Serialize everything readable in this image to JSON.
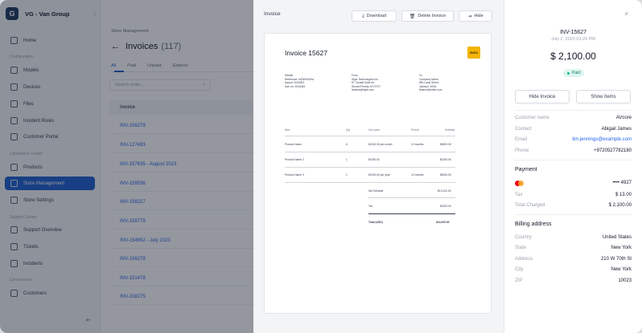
{
  "brand": {
    "initial": "G",
    "name": "VG - Van Group",
    "chevron": "›"
  },
  "sidebar": {
    "sections": {
      "configuration": "Configuration",
      "commerce": "Commerce Center",
      "support": "Support Center",
      "connections": "Connections"
    },
    "items": [
      {
        "label": "Home"
      },
      {
        "label": "Models"
      },
      {
        "label": "Devices"
      },
      {
        "label": "Files"
      },
      {
        "label": "Incident Rules"
      },
      {
        "label": "Customer Portal"
      },
      {
        "label": "Products"
      },
      {
        "label": "Store Management"
      },
      {
        "label": "Store Settings"
      },
      {
        "label": "Support Overview"
      },
      {
        "label": "Tickets"
      },
      {
        "label": "Incidents"
      },
      {
        "label": "Customers"
      }
    ],
    "collapse_icon": "⇤"
  },
  "main": {
    "breadcrumb": "Store Management",
    "title": "Invoices",
    "count": "(117)",
    "back_icon": "←",
    "tabs": [
      "All",
      "Paid",
      "Unpaid",
      "Expired"
    ],
    "search_placeholder": "Search order...",
    "search_icon": "⌕",
    "column": "Invoice",
    "rows": [
      "INV-156279",
      "INV-127493",
      "INV-157635 - August 2023",
      "INV-159536",
      "INV-156227",
      "INV-158779",
      "INV-154652 - July 2023",
      "INV-156279",
      "INV-151478",
      "INV-158275"
    ]
  },
  "preview": {
    "title": "Invoice",
    "download": "Download",
    "delete": "Delete Invoice",
    "hide": "Hide",
    "doc": {
      "title": "Invoice 15627",
      "logo_text": "AVCO",
      "details": [
        "Details",
        "Reference: M20EHU09a",
        "Issued: 2034/8/1",
        "Due on: 2034/8/4"
      ],
      "from": [
        "From",
        "Style Technologies Inc.",
        "87 Tyndall Suite #a",
        "Stoned Florida, M 07077",
        "finance@style.com"
      ],
      "to": [
        "To",
        "Company Name",
        "890 Lassi Street,",
        "Jackson, 8234",
        "finance@other.com"
      ],
      "headers": [
        "Item",
        "Qty",
        "Unit price",
        "Period",
        "Subtotal"
      ],
      "items": [
        [
          "Product Name",
          "6",
          "$1000.00 per month",
          "12 months",
          "$5000.00"
        ],
        [
          "Product Name 2",
          "1",
          "$1000.00",
          "",
          "$1000.00"
        ],
        [
          "Product Name 3",
          "1",
          "$1000.00 per year",
          "12 months",
          "$5000.00"
        ]
      ],
      "subtotal_label": "Net Subtotal",
      "subtotal": "$12,000.00",
      "tax_label": "Tax",
      "tax": "$2000.00",
      "total_label": "Total (USD)",
      "total": "$14,000.00"
    }
  },
  "detail": {
    "close_icon": "×",
    "id": "INV-15627",
    "date": "July 2, 2020 03:29 PM",
    "amount": "$ 2,100.00",
    "status": "Paid",
    "hide_btn": "Hide Invoice",
    "show_btn": "Show Items",
    "customer": [
      {
        "k": "Customer name",
        "v": "AVcore"
      },
      {
        "k": "Contact",
        "v": "Abigail James"
      },
      {
        "k": "Email",
        "v": "tim.jennings@example.com"
      },
      {
        "k": "Phone",
        "v": "+972052778218​0"
      }
    ],
    "payment_title": "Payment",
    "card": "•••• 4927",
    "payment": [
      {
        "k": "Tax",
        "v": "$ 13.00"
      },
      {
        "k": "Total Charged",
        "v": "$ 2,100.00"
      }
    ],
    "billing_title": "Billing address",
    "billing": [
      {
        "k": "Country",
        "v": "United States"
      },
      {
        "k": "State",
        "v": "New York"
      },
      {
        "k": "Address",
        "v": "210 W 70th St"
      },
      {
        "k": "City",
        "v": "New York"
      },
      {
        "k": "ZIP",
        "v": "10023"
      }
    ]
  }
}
